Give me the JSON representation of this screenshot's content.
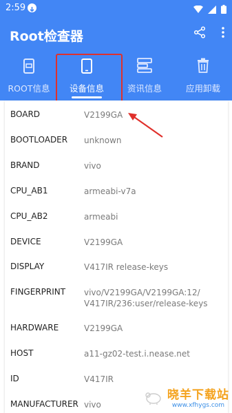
{
  "statusbar": {
    "time": "2:59"
  },
  "app": {
    "title": "Root检查器"
  },
  "tabs": [
    {
      "label": "ROOT信息",
      "icon": "device-frame-icon"
    },
    {
      "label": "设备信息",
      "icon": "phone-icon"
    },
    {
      "label": "资讯信息",
      "icon": "list-icon"
    },
    {
      "label": "应用卸载",
      "icon": "trash-icon"
    }
  ],
  "active_tab": "设备信息",
  "properties": [
    {
      "key": "BOARD",
      "value": "V2199GA"
    },
    {
      "key": "BOOTLOADER",
      "value": "unknown"
    },
    {
      "key": "BRAND",
      "value": "vivo"
    },
    {
      "key": "CPU_AB1",
      "value": "armeabi-v7a"
    },
    {
      "key": "CPU_AB2",
      "value": "armeabi"
    },
    {
      "key": "DEVICE",
      "value": "V2199GA"
    },
    {
      "key": "DISPLAY",
      "value": "V417IR release-keys"
    },
    {
      "key": "FINGERPRINT",
      "value": "vivo/V2199GA/V2199GA:12/\nV417IR/236:user/release-keys"
    },
    {
      "key": "HARDWARE",
      "value": "V2199GA"
    },
    {
      "key": "HOST",
      "value": "a11-gz02-test.i.nease.net"
    },
    {
      "key": "ID",
      "value": "V417IR"
    },
    {
      "key": "MANUFACTURER",
      "value": "vivo"
    }
  ],
  "watermark": {
    "text": "晓羊下载站",
    "url": "www.xfhygs.com"
  },
  "colors": {
    "primary": "#4286f5",
    "annotation": "#e0302b",
    "watermark": "#f4a21c"
  }
}
